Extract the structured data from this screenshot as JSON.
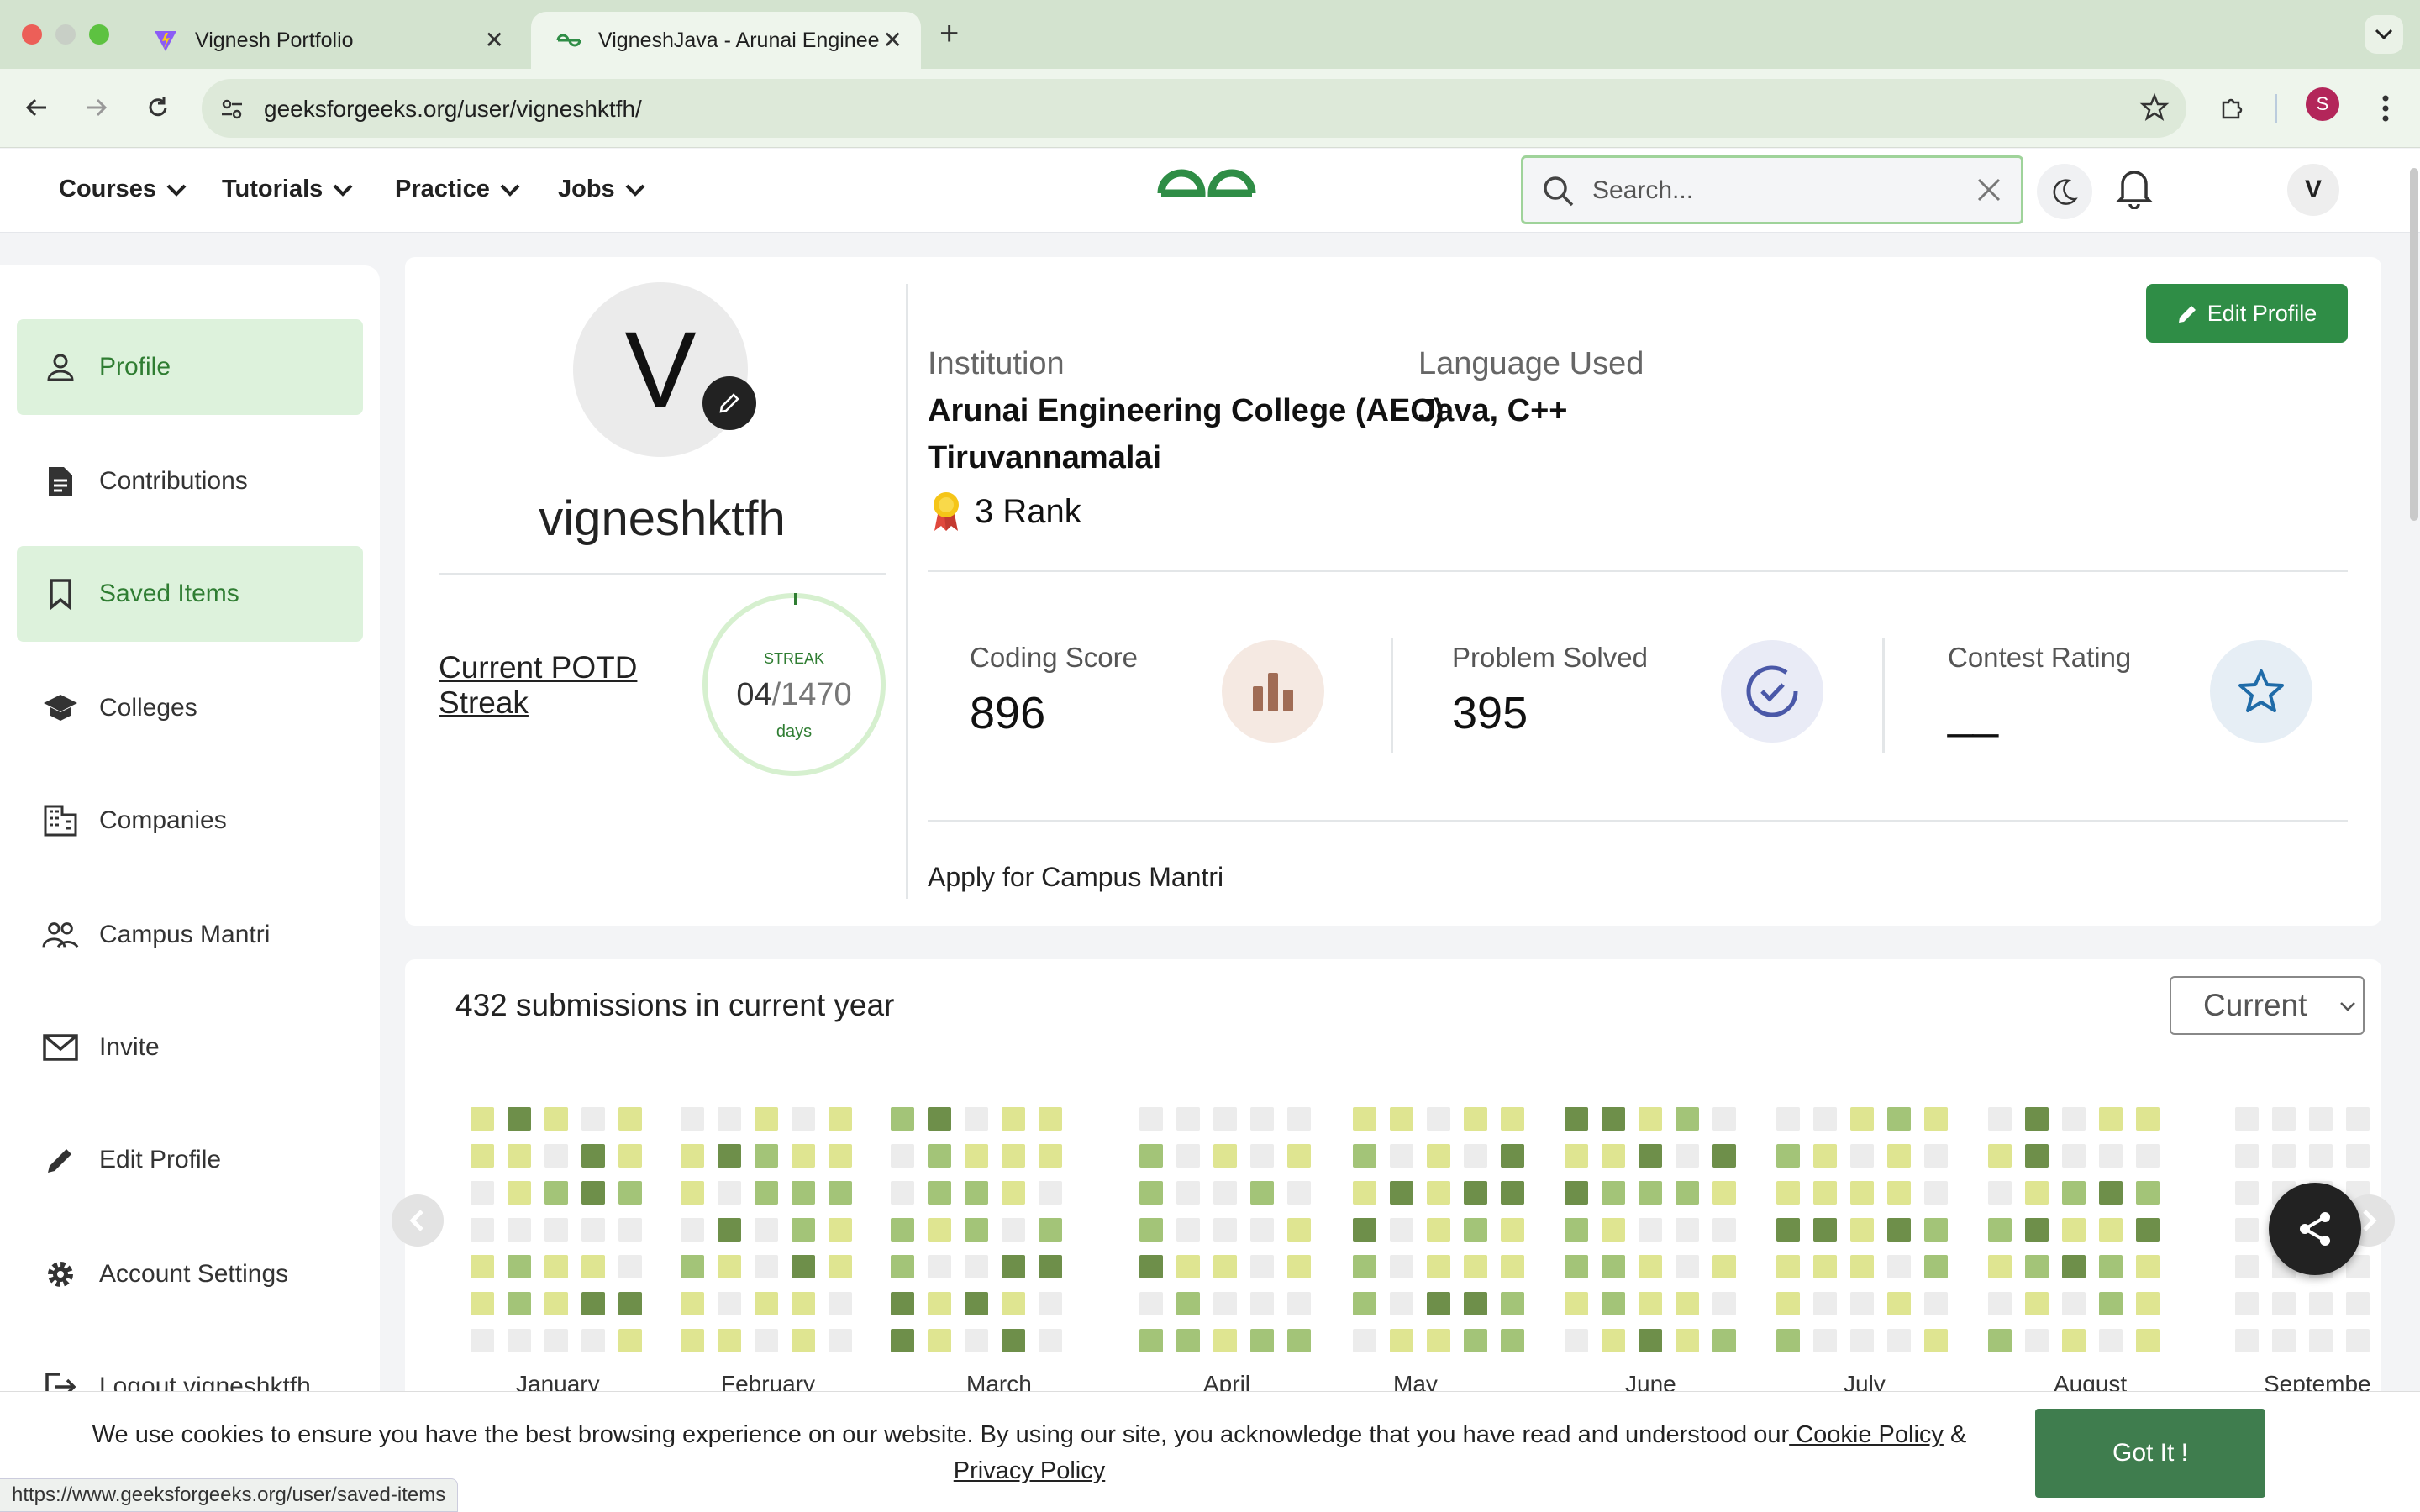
{
  "browser": {
    "tabs": [
      {
        "title": "Vignesh Portfolio",
        "icon": "vite-logo-icon",
        "active": false
      },
      {
        "title": "VigneshJava - Arunai Enginee",
        "icon": "gfg-logo-icon",
        "active": true
      }
    ],
    "url": "geeksforgeeks.org/user/vigneshktfh/",
    "profile_initial": "S",
    "status_url": "https://www.geeksforgeeks.org/user/saved-items"
  },
  "header": {
    "menu": [
      {
        "label": "Courses"
      },
      {
        "label": "Tutorials"
      },
      {
        "label": "Practice"
      },
      {
        "label": "Jobs"
      }
    ],
    "search_placeholder": "Search...",
    "avatar_initial": "V",
    "accent": "#2f8d46"
  },
  "sidebar": {
    "items": [
      {
        "label": "Profile",
        "icon": "person-icon",
        "highlighted": true
      },
      {
        "label": "Contributions",
        "icon": "document-icon",
        "highlighted": false
      },
      {
        "label": "Saved Items",
        "icon": "bookmark-icon",
        "highlighted": true
      },
      {
        "label": "Colleges",
        "icon": "graduation-cap-icon",
        "highlighted": false
      },
      {
        "label": "Companies",
        "icon": "building-icon",
        "highlighted": false
      },
      {
        "label": "Campus Mantri",
        "icon": "people-icon",
        "highlighted": false
      },
      {
        "label": "Invite",
        "icon": "mail-icon",
        "highlighted": false
      },
      {
        "label": "Edit Profile",
        "icon": "pencil-icon",
        "highlighted": false
      },
      {
        "label": "Account Settings",
        "icon": "gear-icon",
        "highlighted": false
      },
      {
        "label": "Logout vigneshktfh",
        "icon": "logout-icon",
        "highlighted": false
      }
    ]
  },
  "profile": {
    "avatar_initial": "V",
    "username": "vigneshktfh",
    "potd_label": "Current POTD Streak",
    "streak_label": "STREAK",
    "streak_current": "04",
    "streak_total": "/1470",
    "streak_unit": "days",
    "institution_label": "Institution",
    "institution_line1": "Arunai Engineering College (AEC)",
    "institution_line2": "Tiruvannamalai",
    "language_label": "Language Used",
    "language_value": "Java, C++",
    "rank_text": "3 Rank",
    "edit_button": "Edit Profile",
    "stats": [
      {
        "label": "Coding Score",
        "value": "896",
        "icon": "bar-chart-icon"
      },
      {
        "label": "Problem Solved",
        "value": "395",
        "icon": "check-circle-icon"
      },
      {
        "label": "Contest Rating",
        "value": "__",
        "icon": "star-icon"
      }
    ],
    "campus_link": "Apply for Campus Mantri"
  },
  "submissions": {
    "title": "432 submissions in current year",
    "filter_selected": "Current",
    "months": [
      "January",
      "February",
      "March",
      "April",
      "May",
      "June",
      "July",
      "August",
      "Septembe"
    ],
    "palette": [
      "#ececec",
      "#dfe591",
      "#a3c478",
      "#6e8f4a",
      "#5a7a38"
    ]
  },
  "cookie": {
    "text": "We use cookies to ensure you have the best browsing experience on our website. By using our site, you acknowledge that you have read and understood our",
    "cookie_link": " Cookie Policy",
    "amp": " & ",
    "privacy_link": "Privacy Policy",
    "button": "Got It !"
  }
}
